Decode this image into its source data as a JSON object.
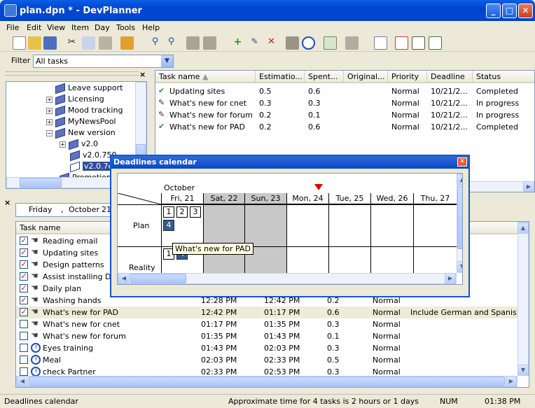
{
  "window": {
    "title": "plan.dpn * - DevPlanner"
  },
  "menu": [
    "File",
    "Edit",
    "View",
    "Item",
    "Day",
    "Tools",
    "Help"
  ],
  "filter": {
    "label": "Filter",
    "value": "All tasks"
  },
  "tree": {
    "items": [
      {
        "label": "Leave support"
      },
      {
        "label": "Licensing"
      },
      {
        "label": "Mood tracking"
      },
      {
        "label": "MyNewsPool"
      },
      {
        "label": "New version"
      },
      {
        "label": "v2.0"
      },
      {
        "label": "v2.0.750"
      },
      {
        "label": "v2.0.7e"
      },
      {
        "label": "Promotional"
      }
    ]
  },
  "tasks_top": {
    "columns": [
      "Task name",
      "Estimatio...",
      "Spent...",
      "Original...",
      "Priority",
      "Deadline",
      "Status"
    ],
    "rows": [
      {
        "name": "Updating sites",
        "est": "0.5",
        "spent": "0.6",
        "orig": "",
        "prio": "Normal",
        "deadline": "10/21/2...",
        "status": "Completed",
        "icon": "check"
      },
      {
        "name": "What's new for cnet",
        "est": "0.3",
        "spent": "0.3",
        "orig": "",
        "prio": "Normal",
        "deadline": "10/21/2...",
        "status": "In progress",
        "icon": "pencil"
      },
      {
        "name": "What's new for forum",
        "est": "0.2",
        "spent": "0.1",
        "orig": "",
        "prio": "Normal",
        "deadline": "10/21/2...",
        "status": "In progress",
        "icon": "pencil"
      },
      {
        "name": "What's new for PAD",
        "est": "0.2",
        "spent": "0.6",
        "orig": "",
        "prio": "Normal",
        "deadline": "10/21/2...",
        "status": "Completed",
        "icon": "check"
      }
    ]
  },
  "day": {
    "weekday": "Friday",
    "sep": ",",
    "month": "October",
    "date": "21"
  },
  "tasks_bottom": {
    "columns": [
      "Task name"
    ],
    "rows": [
      {
        "name": "Reading email",
        "checked": true,
        "icon": "hand",
        "start": "",
        "end": "",
        "val": "",
        "prio": "",
        "note": ""
      },
      {
        "name": "Updating sites",
        "checked": true,
        "icon": "hand",
        "start": "",
        "end": "",
        "val": "",
        "prio": "",
        "note": ""
      },
      {
        "name": "Design patterns",
        "checked": true,
        "icon": "hand",
        "start": "",
        "end": "",
        "val": "",
        "prio": "",
        "note": ""
      },
      {
        "name": "Assist installing DCO",
        "checked": true,
        "icon": "hand",
        "start": "",
        "end": "",
        "val": "",
        "prio": "",
        "note": ""
      },
      {
        "name": "Daily plan",
        "checked": true,
        "icon": "hand",
        "start": "",
        "end": "",
        "val": "",
        "prio": "",
        "note": ""
      },
      {
        "name": "Washing hands",
        "checked": true,
        "icon": "hand",
        "start": "12:28 PM",
        "end": "12:42 PM",
        "val": "0.2",
        "prio": "Normal",
        "note": ""
      },
      {
        "name": "What's new for PAD",
        "checked": true,
        "icon": "hand",
        "start": "12:42 PM",
        "end": "01:17 PM",
        "val": "0.6",
        "prio": "Normal",
        "note": "Include German and Spanish..."
      },
      {
        "name": "What's new for cnet",
        "checked": false,
        "icon": "hand",
        "start": "01:17 PM",
        "end": "01:35 PM",
        "val": "0.3",
        "prio": "Normal",
        "note": ""
      },
      {
        "name": "What's new for forum",
        "checked": false,
        "icon": "hand",
        "start": "01:35 PM",
        "end": "01:43 PM",
        "val": "0.1",
        "prio": "Normal",
        "note": ""
      },
      {
        "name": "Eyes training",
        "checked": false,
        "icon": "clock",
        "start": "01:43 PM",
        "end": "02:03 PM",
        "val": "0.3",
        "prio": "Normal",
        "note": ""
      },
      {
        "name": "Meal",
        "checked": false,
        "icon": "clock",
        "start": "02:03 PM",
        "end": "02:33 PM",
        "val": "0.5",
        "prio": "Normal",
        "note": ""
      },
      {
        "name": "check Partner",
        "checked": false,
        "icon": "clock",
        "start": "02:33 PM",
        "end": "02:53 PM",
        "val": "0.3",
        "prio": "Normal",
        "note": ""
      }
    ]
  },
  "dialog": {
    "title": "Deadlines calendar",
    "month": "October",
    "days": [
      "Fri, 21",
      "Sat, 22",
      "Sun, 23",
      "Mon, 24",
      "Tue, 25",
      "Wed, 26",
      "Thu, 27"
    ],
    "rows": [
      "Plan",
      "Reality"
    ],
    "plan_boxes": [
      "1",
      "2",
      "3",
      "4"
    ],
    "reality_boxes": [
      "1",
      "4"
    ],
    "tooltip": "What's new for PAD"
  },
  "status": {
    "left": "Deadlines calendar",
    "middle": "Approximate time for 4 tasks is 2 hours or 1 days",
    "num": "NUM",
    "time": "01:38 PM"
  }
}
